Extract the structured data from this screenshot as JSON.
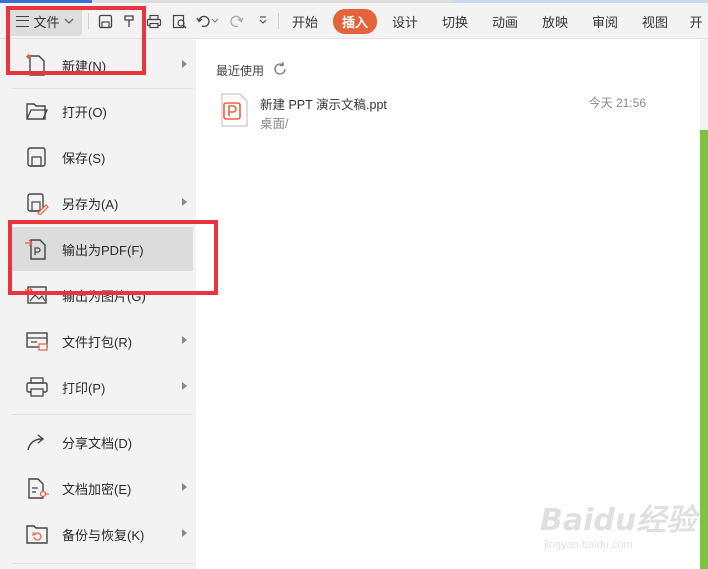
{
  "toolbar": {
    "file_label": "文件",
    "tabs": [
      "开始",
      "插入",
      "设计",
      "切换",
      "动画",
      "放映",
      "审阅",
      "视图",
      "开"
    ],
    "active_tab_index": 1
  },
  "menu": {
    "items": [
      {
        "label": "新建(N)",
        "icon": "new-file-icon",
        "submenu": true
      },
      {
        "label": "打开(O)",
        "icon": "folder-open-icon",
        "submenu": false
      },
      {
        "label": "保存(S)",
        "icon": "save-icon",
        "submenu": false
      },
      {
        "label": "另存为(A)",
        "icon": "save-as-icon",
        "submenu": true
      },
      {
        "label": "输出为PDF(F)",
        "icon": "export-pdf-icon",
        "submenu": false
      },
      {
        "label": "输出为图片(G)",
        "icon": "export-image-icon",
        "submenu": false
      },
      {
        "label": "文件打包(R)",
        "icon": "package-icon",
        "submenu": true
      },
      {
        "label": "打印(P)",
        "icon": "print-icon",
        "submenu": true
      },
      {
        "label": "分享文档(D)",
        "icon": "share-icon",
        "submenu": false
      },
      {
        "label": "文档加密(E)",
        "icon": "encrypt-icon",
        "submenu": true
      },
      {
        "label": "备份与恢复(K)",
        "icon": "backup-icon",
        "submenu": true
      }
    ],
    "active_index": 4
  },
  "recent": {
    "title": "最近使用",
    "files": [
      {
        "name": "新建 PPT 演示文稿.ppt",
        "path": "桌面/",
        "time": "今天 21:56"
      }
    ]
  },
  "watermark": {
    "brand": "Baidu经验",
    "url": "jingyan.baidu.com"
  },
  "colors": {
    "accent": "#e5633a",
    "highlight": "#e8343c",
    "selection": "#dcdcdc"
  }
}
